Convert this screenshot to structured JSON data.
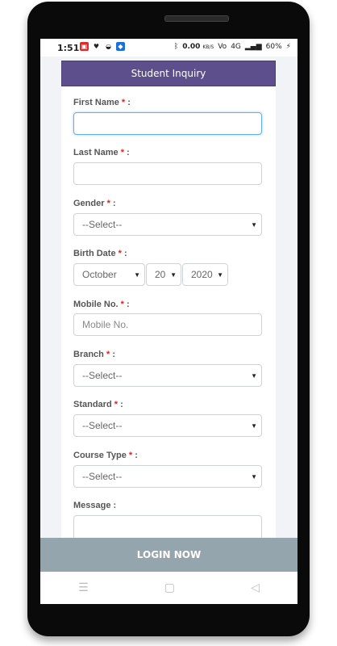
{
  "status_bar": {
    "time": "1:51",
    "battery": "60%",
    "net_speed": "0.00",
    "net_unit": "KB/S",
    "network": "4G",
    "volte": "Vo",
    "icons": [
      "notification-app-icon",
      "heart-shield-icon",
      "bowl-icon",
      "app-badge-icon",
      "bluetooth-icon",
      "signal-icon",
      "battery-icon"
    ]
  },
  "form": {
    "header_title": "Student Inquiry",
    "required_mark": "*",
    "first_name": {
      "label": "First Name",
      "value": ""
    },
    "last_name": {
      "label": "Last Name",
      "value": ""
    },
    "gender": {
      "label": "Gender",
      "selected": "--Select--"
    },
    "birth_date": {
      "label": "Birth Date",
      "month": "October",
      "day": "20",
      "year": "2020"
    },
    "mobile": {
      "label": "Mobile No.",
      "placeholder": "Mobile No."
    },
    "branch": {
      "label": "Branch",
      "selected": "--Select--"
    },
    "standard": {
      "label": "Standard",
      "selected": "--Select--"
    },
    "course_type": {
      "label": "Course Type",
      "selected": "--Select--"
    },
    "message": {
      "label": "Message :"
    },
    "colon": ":"
  },
  "login_button": "LOGIN NOW",
  "nav": {
    "icons": [
      "menu-icon",
      "home-square-icon",
      "back-triangle-icon"
    ]
  },
  "colors": {
    "header": "#5c4f8c",
    "button": "#95a5ad",
    "required": "#d9241c"
  }
}
